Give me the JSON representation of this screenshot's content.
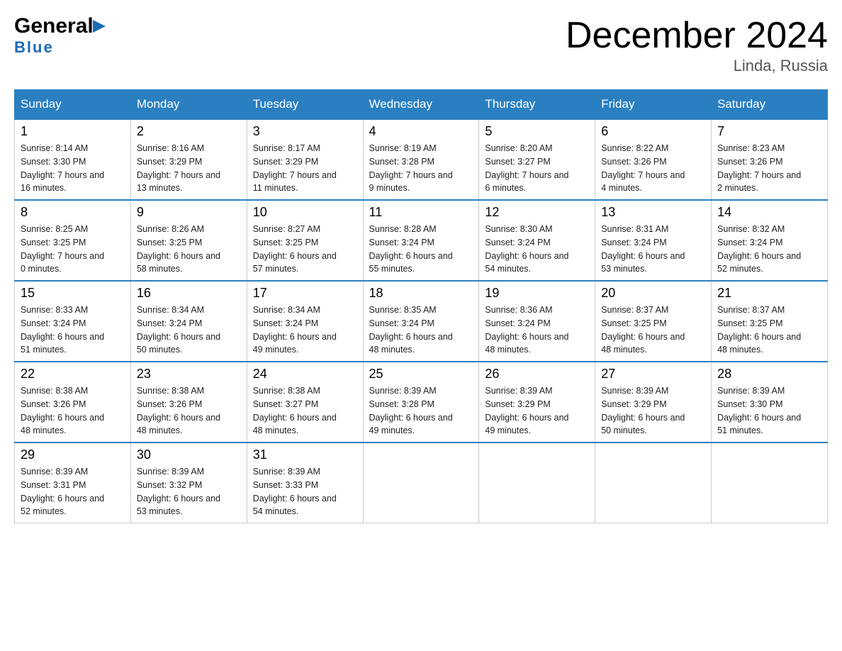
{
  "header": {
    "title": "December 2024",
    "subtitle": "Linda, Russia",
    "logo_general": "General",
    "logo_blue": "Blue"
  },
  "weekdays": [
    "Sunday",
    "Monday",
    "Tuesday",
    "Wednesday",
    "Thursday",
    "Friday",
    "Saturday"
  ],
  "weeks": [
    [
      {
        "day": "1",
        "sunrise": "8:14 AM",
        "sunset": "3:30 PM",
        "daylight": "7 hours and 16 minutes."
      },
      {
        "day": "2",
        "sunrise": "8:16 AM",
        "sunset": "3:29 PM",
        "daylight": "7 hours and 13 minutes."
      },
      {
        "day": "3",
        "sunrise": "8:17 AM",
        "sunset": "3:29 PM",
        "daylight": "7 hours and 11 minutes."
      },
      {
        "day": "4",
        "sunrise": "8:19 AM",
        "sunset": "3:28 PM",
        "daylight": "7 hours and 9 minutes."
      },
      {
        "day": "5",
        "sunrise": "8:20 AM",
        "sunset": "3:27 PM",
        "daylight": "7 hours and 6 minutes."
      },
      {
        "day": "6",
        "sunrise": "8:22 AM",
        "sunset": "3:26 PM",
        "daylight": "7 hours and 4 minutes."
      },
      {
        "day": "7",
        "sunrise": "8:23 AM",
        "sunset": "3:26 PM",
        "daylight": "7 hours and 2 minutes."
      }
    ],
    [
      {
        "day": "8",
        "sunrise": "8:25 AM",
        "sunset": "3:25 PM",
        "daylight": "7 hours and 0 minutes."
      },
      {
        "day": "9",
        "sunrise": "8:26 AM",
        "sunset": "3:25 PM",
        "daylight": "6 hours and 58 minutes."
      },
      {
        "day": "10",
        "sunrise": "8:27 AM",
        "sunset": "3:25 PM",
        "daylight": "6 hours and 57 minutes."
      },
      {
        "day": "11",
        "sunrise": "8:28 AM",
        "sunset": "3:24 PM",
        "daylight": "6 hours and 55 minutes."
      },
      {
        "day": "12",
        "sunrise": "8:30 AM",
        "sunset": "3:24 PM",
        "daylight": "6 hours and 54 minutes."
      },
      {
        "day": "13",
        "sunrise": "8:31 AM",
        "sunset": "3:24 PM",
        "daylight": "6 hours and 53 minutes."
      },
      {
        "day": "14",
        "sunrise": "8:32 AM",
        "sunset": "3:24 PM",
        "daylight": "6 hours and 52 minutes."
      }
    ],
    [
      {
        "day": "15",
        "sunrise": "8:33 AM",
        "sunset": "3:24 PM",
        "daylight": "6 hours and 51 minutes."
      },
      {
        "day": "16",
        "sunrise": "8:34 AM",
        "sunset": "3:24 PM",
        "daylight": "6 hours and 50 minutes."
      },
      {
        "day": "17",
        "sunrise": "8:34 AM",
        "sunset": "3:24 PM",
        "daylight": "6 hours and 49 minutes."
      },
      {
        "day": "18",
        "sunrise": "8:35 AM",
        "sunset": "3:24 PM",
        "daylight": "6 hours and 48 minutes."
      },
      {
        "day": "19",
        "sunrise": "8:36 AM",
        "sunset": "3:24 PM",
        "daylight": "6 hours and 48 minutes."
      },
      {
        "day": "20",
        "sunrise": "8:37 AM",
        "sunset": "3:25 PM",
        "daylight": "6 hours and 48 minutes."
      },
      {
        "day": "21",
        "sunrise": "8:37 AM",
        "sunset": "3:25 PM",
        "daylight": "6 hours and 48 minutes."
      }
    ],
    [
      {
        "day": "22",
        "sunrise": "8:38 AM",
        "sunset": "3:26 PM",
        "daylight": "6 hours and 48 minutes."
      },
      {
        "day": "23",
        "sunrise": "8:38 AM",
        "sunset": "3:26 PM",
        "daylight": "6 hours and 48 minutes."
      },
      {
        "day": "24",
        "sunrise": "8:38 AM",
        "sunset": "3:27 PM",
        "daylight": "6 hours and 48 minutes."
      },
      {
        "day": "25",
        "sunrise": "8:39 AM",
        "sunset": "3:28 PM",
        "daylight": "6 hours and 49 minutes."
      },
      {
        "day": "26",
        "sunrise": "8:39 AM",
        "sunset": "3:29 PM",
        "daylight": "6 hours and 49 minutes."
      },
      {
        "day": "27",
        "sunrise": "8:39 AM",
        "sunset": "3:29 PM",
        "daylight": "6 hours and 50 minutes."
      },
      {
        "day": "28",
        "sunrise": "8:39 AM",
        "sunset": "3:30 PM",
        "daylight": "6 hours and 51 minutes."
      }
    ],
    [
      {
        "day": "29",
        "sunrise": "8:39 AM",
        "sunset": "3:31 PM",
        "daylight": "6 hours and 52 minutes."
      },
      {
        "day": "30",
        "sunrise": "8:39 AM",
        "sunset": "3:32 PM",
        "daylight": "6 hours and 53 minutes."
      },
      {
        "day": "31",
        "sunrise": "8:39 AM",
        "sunset": "3:33 PM",
        "daylight": "6 hours and 54 minutes."
      },
      null,
      null,
      null,
      null
    ]
  ],
  "labels": {
    "sunrise": "Sunrise:",
    "sunset": "Sunset:",
    "daylight": "Daylight:"
  }
}
